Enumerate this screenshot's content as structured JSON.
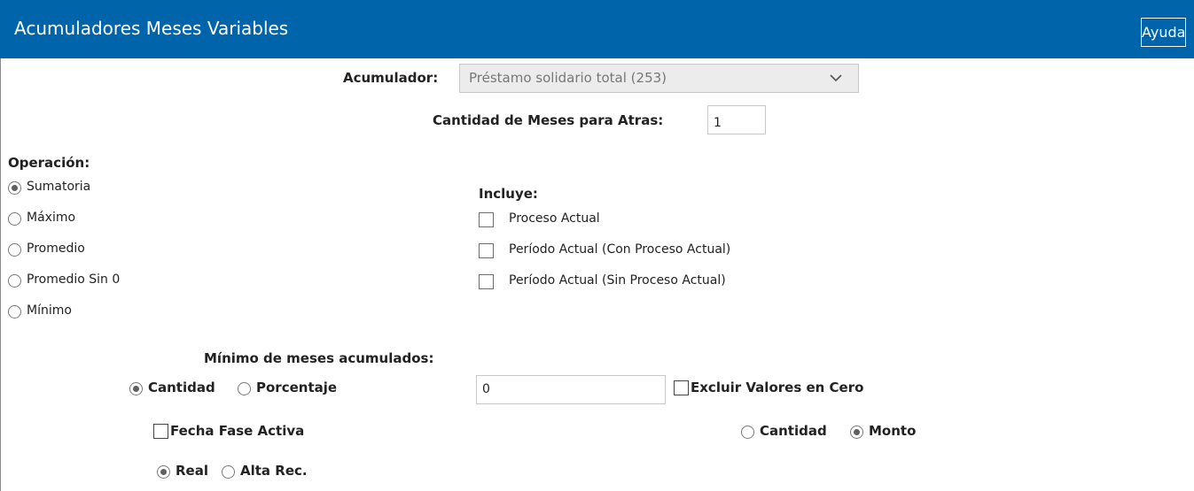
{
  "header": {
    "title": "Acumuladores Meses Variables",
    "help_label": "Ayuda",
    "bg_color": "#0064aa"
  },
  "acumulador": {
    "label": "Acumulador:",
    "selected": "Préstamo solidario total (253)"
  },
  "meses_atras": {
    "label": "Cantidad de Meses para Atras:",
    "value": "1"
  },
  "operacion": {
    "title": "Operación:",
    "options": [
      {
        "label": "Sumatoria",
        "checked": true
      },
      {
        "label": "Máximo",
        "checked": false
      },
      {
        "label": "Promedio",
        "checked": false
      },
      {
        "label": "Promedio Sin 0",
        "checked": false
      },
      {
        "label": "Mínimo",
        "checked": false
      }
    ]
  },
  "incluye": {
    "title": "Incluye:",
    "options": [
      {
        "label": "Proceso Actual",
        "checked": false
      },
      {
        "label": "Período Actual (Con Proceso Actual)",
        "checked": false
      },
      {
        "label": "Período Actual (Sin Proceso Actual)",
        "checked": false
      }
    ]
  },
  "minimo_meses": {
    "title": "Mínimo de meses acumulados:",
    "cantidad_label": "Cantidad",
    "porcentaje_label": "Porcentaje",
    "mode": "Cantidad",
    "value": "0",
    "excluir_label": "Excluir Valores en Cero",
    "excluir_checked": false
  },
  "fecha_fase": {
    "label": "Fecha Fase Activa",
    "checked": false
  },
  "tipo_valor": {
    "cantidad_label": "Cantidad",
    "monto_label": "Monto",
    "selected": "Monto"
  },
  "fecha_tipo": {
    "real_label": "Real",
    "alta_label": "Alta Rec.",
    "selected": "Real"
  }
}
